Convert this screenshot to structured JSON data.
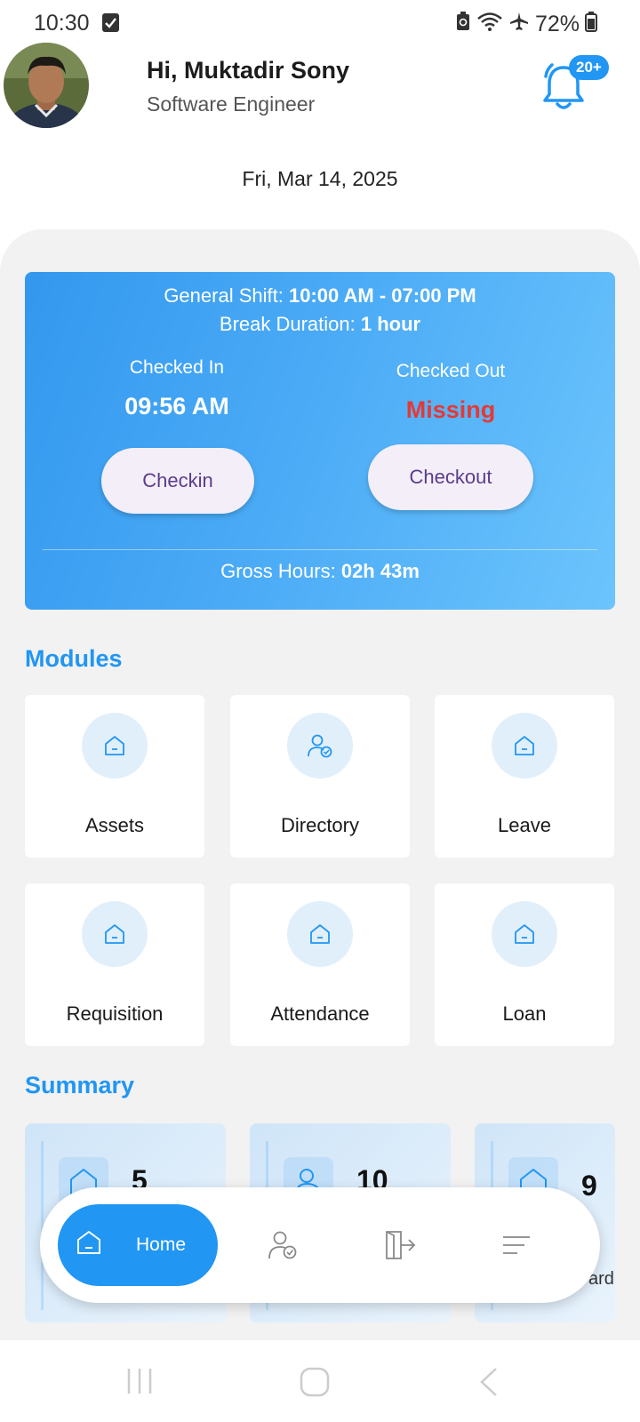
{
  "status_bar": {
    "time": "10:30",
    "battery": "72%"
  },
  "user": {
    "greeting": "Hi, Muktadir Sony",
    "role": "Software Engineer",
    "notification_count": "20+"
  },
  "date": "Fri, Mar 14, 2025",
  "shift": {
    "shift_label": "General Shift:",
    "shift_time": "10:00 AM - 07:00 PM",
    "break_label": "Break Duration:",
    "break_value": "1 hour",
    "checked_in_label": "Checked In",
    "checked_in_value": "09:56 AM",
    "checked_out_label": "Checked Out",
    "checked_out_value": "Missing",
    "checkin_button": "Checkin",
    "checkout_button": "Checkout",
    "gross_label": "Gross Hours:",
    "gross_value": "02h 43m",
    "missing_color": "#e53935"
  },
  "modules": {
    "title": "Modules",
    "items": [
      {
        "label": "Assets",
        "icon": "home-icon"
      },
      {
        "label": "Directory",
        "icon": "user-check-icon"
      },
      {
        "label": "Leave",
        "icon": "home-icon"
      },
      {
        "label": "Requisition",
        "icon": "home-icon"
      },
      {
        "label": "Attendance",
        "icon": "home-icon"
      },
      {
        "label": "Loan",
        "icon": "home-icon"
      }
    ]
  },
  "summary": {
    "title": "Summary",
    "items": [
      {
        "value": "5",
        "label": "",
        "icon": "home-icon"
      },
      {
        "value": "10",
        "label": "",
        "icon": "user-icon"
      },
      {
        "value": "9",
        "label": "ard",
        "icon": "home-icon"
      }
    ]
  },
  "bottom_nav": {
    "home_label": "Home",
    "items": [
      "home-icon",
      "user-check-icon",
      "logout-icon",
      "menu-icon"
    ]
  },
  "colors": {
    "accent": "#2196f3",
    "card_gradient_start": "#3398ee",
    "card_gradient_end": "#6cc4fc"
  }
}
